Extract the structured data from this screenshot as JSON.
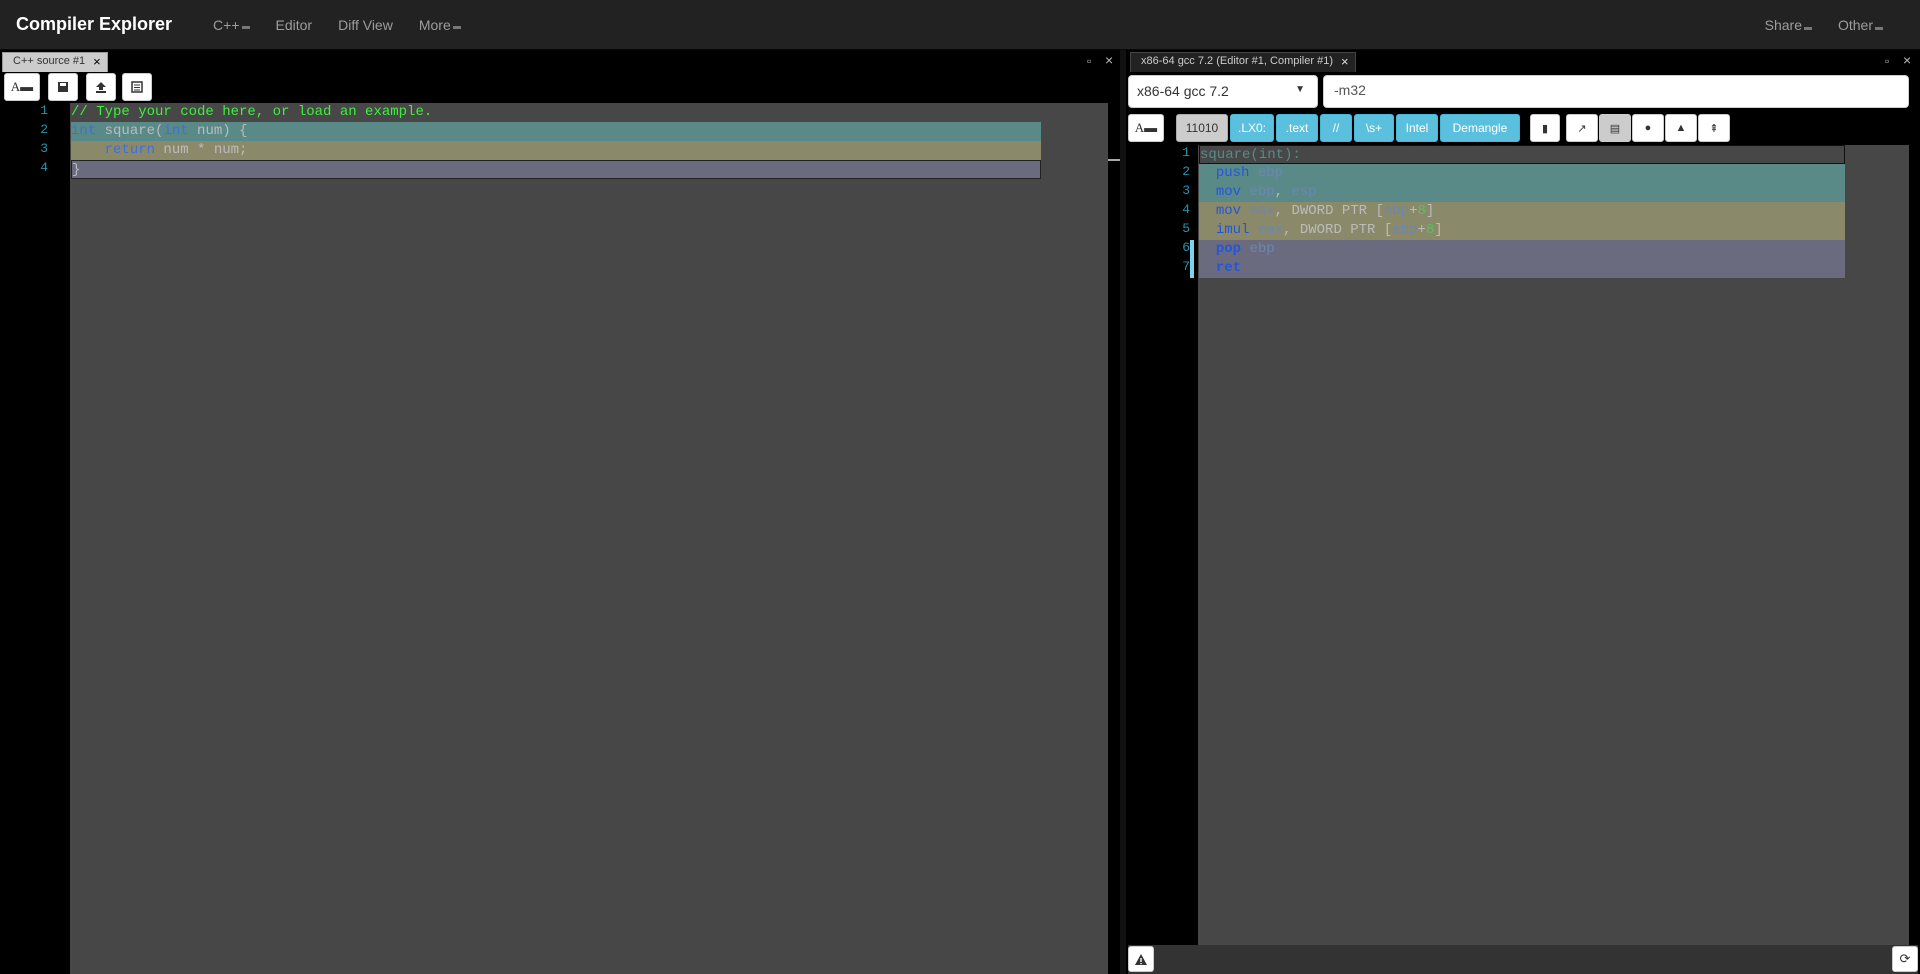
{
  "navbar": {
    "brand": "Compiler Explorer",
    "items": [
      {
        "label": "C++"
      },
      {
        "label": "Editor"
      },
      {
        "label": "Diff View"
      },
      {
        "label": "More"
      }
    ],
    "right_items": [
      {
        "label": "Share"
      },
      {
        "label": "Other"
      }
    ]
  },
  "source_pane": {
    "tab_title": "C++ source #1",
    "lines": [
      {
        "num": "1",
        "text": "// Type your code here, or load an example."
      },
      {
        "num": "2",
        "text": "int square(int num) {"
      },
      {
        "num": "3",
        "text": "    return num * num;"
      },
      {
        "num": "4",
        "text": "}"
      }
    ]
  },
  "compiler_pane": {
    "tab_title": "x86-64 gcc 7.2 (Editor #1, Compiler #1)",
    "compiler": "x86-64 gcc 7.2",
    "options": "-m32",
    "filters": [
      "11010",
      ".LX0:",
      ".text",
      "//",
      "\\s+",
      "Intel",
      "Demangle"
    ],
    "icons": [
      "copy-icon",
      "external-link-icon",
      "output-icon",
      "lightbulb-icon",
      "tree-icon",
      "rtl-icon"
    ],
    "asm_lines": [
      {
        "num": "1",
        "text": "square(int):"
      },
      {
        "num": "2",
        "text": "  push ebp"
      },
      {
        "num": "3",
        "text": "  mov ebp, esp"
      },
      {
        "num": "4",
        "text": "  mov eax, DWORD PTR [ebp+8]"
      },
      {
        "num": "5",
        "text": "  imul eax, DWORD PTR [ebp+8]"
      },
      {
        "num": "6",
        "text": "  pop ebp"
      },
      {
        "num": "7",
        "text": "  ret"
      }
    ]
  },
  "colors": {
    "navbar": "#222222",
    "editor_bg": "#474747",
    "filter_active": "#5bc0de"
  }
}
